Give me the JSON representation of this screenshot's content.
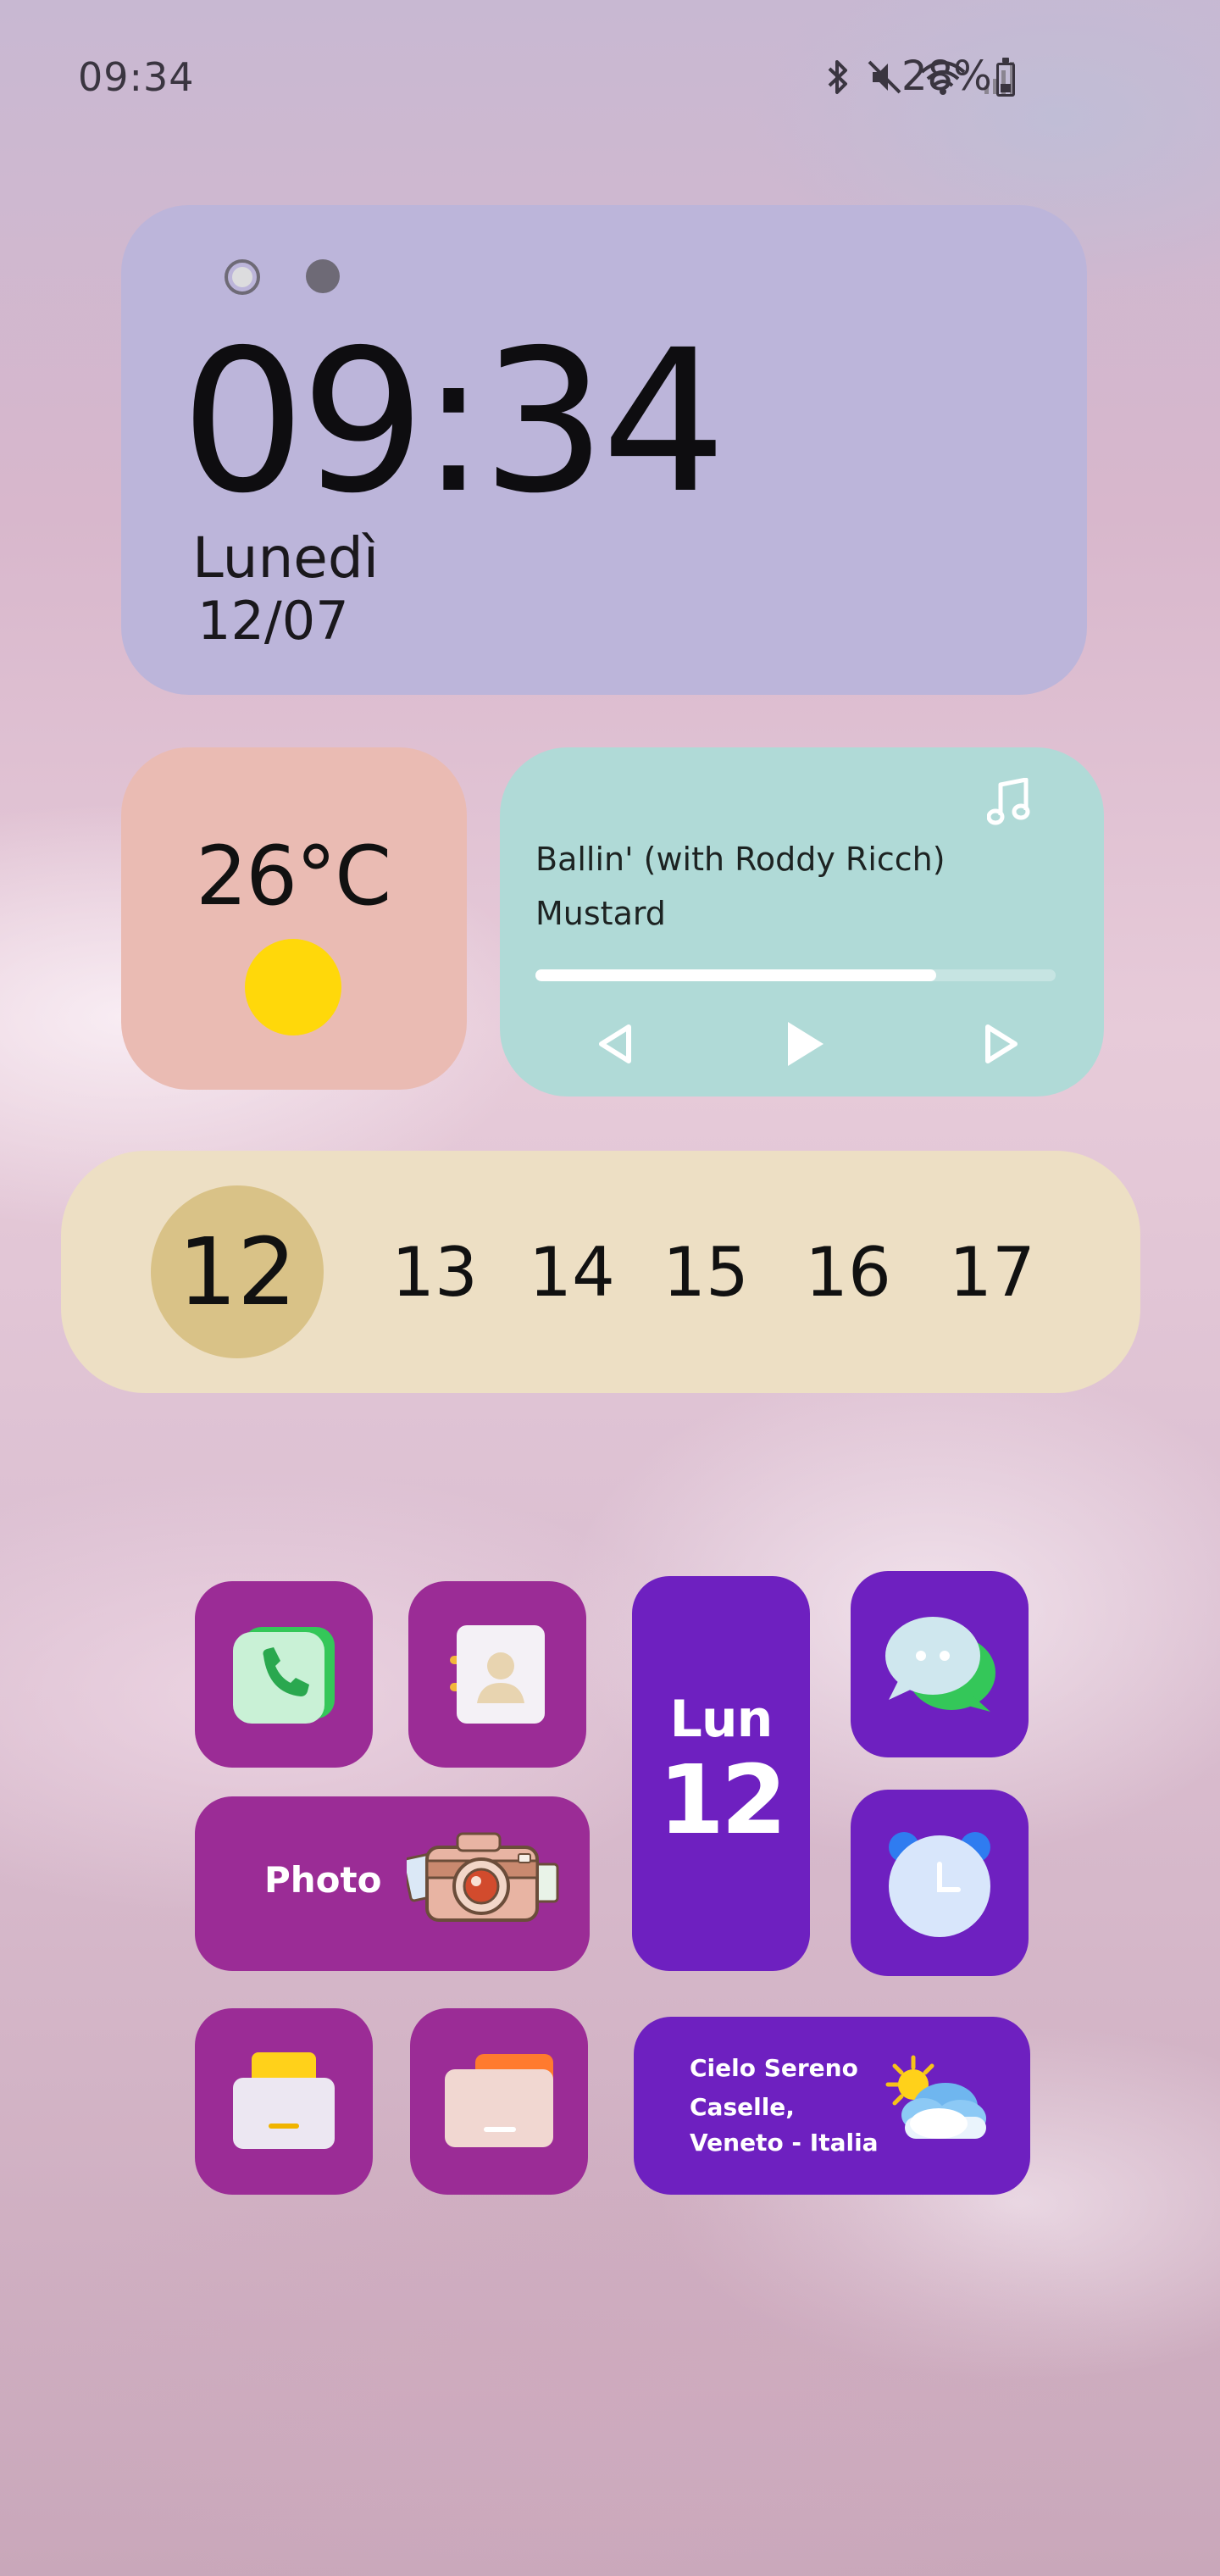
{
  "status_bar": {
    "time": "09:34",
    "battery_percent": "28%",
    "icons": [
      "bluetooth-icon",
      "mute-icon",
      "wifi-icon",
      "signal-icon",
      "battery-icon"
    ]
  },
  "clock_widget": {
    "time": "09:34",
    "day": "Lunedì",
    "date": "12/07",
    "page_indicator": {
      "pages": 2,
      "current": 1
    }
  },
  "weather_widget": {
    "temperature": "26°C",
    "condition_icon": "sun-icon",
    "sun_color": "#ffd80a"
  },
  "music_widget": {
    "title": "Ballin' (with Roddy Ricch)",
    "artist": "Mustard",
    "progress_fraction": 0.77,
    "controls": [
      "previous-icon",
      "play-icon",
      "next-icon"
    ],
    "icon": "music-note-icon"
  },
  "week_strip": {
    "days": [
      "12",
      "13",
      "14",
      "15",
      "16",
      "17"
    ],
    "selected": "12"
  },
  "apps": {
    "phone": {
      "icon": "phone-icon"
    },
    "contacts": {
      "icon": "contacts-icon"
    },
    "photo": {
      "label": "Photo",
      "icon": "camera-icon"
    },
    "calendar": {
      "day": "Lun",
      "date": "12"
    },
    "messages": {
      "icon": "chat-bubbles-icon"
    },
    "alarm": {
      "icon": "alarm-clock-icon"
    },
    "mail": {
      "icon": "mail-icon"
    },
    "files": {
      "icon": "folder-icon"
    },
    "weather": {
      "condition": "Cielo Sereno",
      "location_line1": "Caselle,",
      "location_line2": "Veneto - Italia",
      "icon": "sun-cloud-icon"
    }
  },
  "colors": {
    "clock_widget_bg": "#bcb5da",
    "weather_widget_bg": "#eabbb3",
    "music_widget_bg": "#b0dad7",
    "week_strip_bg": "#eddfc4",
    "week_selected": "#d9c287",
    "app_magenta": "#9b2c96",
    "app_violet": "#6e20c0"
  }
}
